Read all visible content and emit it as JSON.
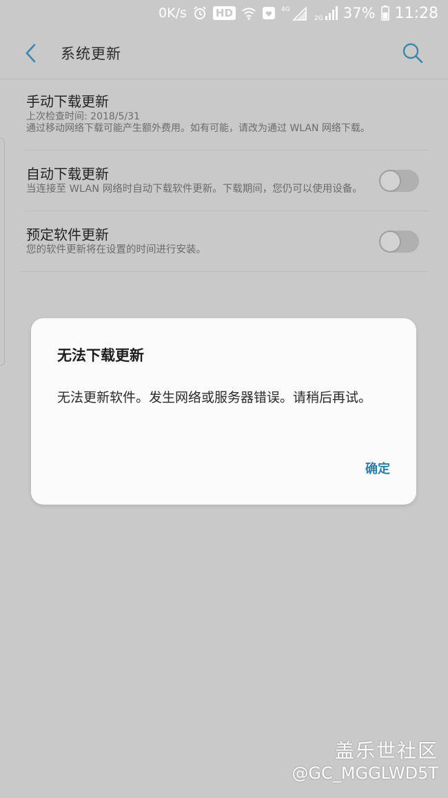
{
  "status_bar": {
    "net_speed": "0K/s",
    "hd_badge": "HD",
    "network_4g": "4G",
    "network_2g": "2G",
    "battery_percent": "37%",
    "time": "11:28"
  },
  "header": {
    "title": "系统更新"
  },
  "items": [
    {
      "title": "手动下载更新",
      "subtitle": "上次检查时间: 2018/5/31",
      "description": "通过移动网络下载可能产生额外费用。如有可能，请改为通过 WLAN 网络下载。"
    },
    {
      "title": "自动下载更新",
      "description": "当连接至 WLAN 网络时自动下载软件更新。下载期间，您仍可以使用设备。",
      "toggle_on": false
    },
    {
      "title": "预定软件更新",
      "description": "您的软件更新将在设置的时间进行安装。",
      "toggle_on": false
    }
  ],
  "dialog": {
    "title": "无法下载更新",
    "message": "无法更新软件。发生网络或服务器错误。请稍后再试。",
    "ok_label": "确定"
  },
  "watermark": {
    "line1": "盖乐世社区",
    "line2": "@GC_MGGLWD5T"
  },
  "colors": {
    "accent": "#2f7ea6",
    "background": "#c9c9c9",
    "dialog_bg": "#fafafa"
  }
}
